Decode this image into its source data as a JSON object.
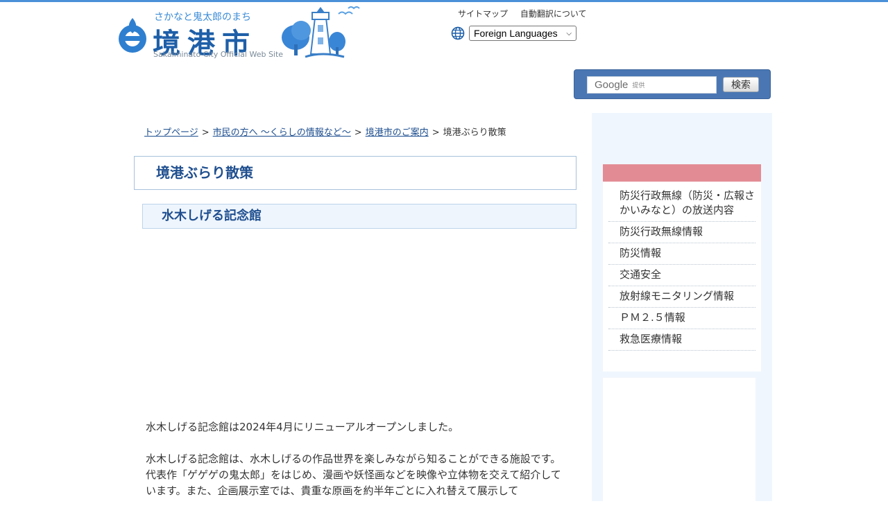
{
  "header": {
    "tagline": "さかなと鬼太郎のまち",
    "title": "境港市",
    "subtitle": "Sakaiminato City Official Web Site",
    "links": [
      "サイトマップ",
      "自動翻訳について"
    ],
    "language_select": "Foreign Languages"
  },
  "search": {
    "brand": "Google",
    "brand_sub": "提供",
    "button": "検索"
  },
  "breadcrumb": [
    "トップページ",
    "市民の方へ 〜くらしの情報など〜",
    "境港市のご案内",
    "境港ぶらり散策"
  ],
  "page_title": "境港ぶらり散策",
  "section_title": "水木しげる記念館",
  "content": {
    "p1": "水木しげる記念館は2024年4月にリニューアルオープンしました。",
    "p2": "水木しげる記念館は、水木しげるの作品世界を楽しみながら知ることができる施設です。代表作「ゲゲゲの鬼太郎」をはじめ、漫画や妖怪画などを映像や立体物を交えて紹介しています。また、企画展示室では、貴重な原画を約半年ごとに入れ替えて展示して"
  },
  "sidebar": {
    "items": [
      "防災行政無線（防災・広報さかいみなと）の放送内容",
      "防災行政無線情報",
      "防災情報",
      "交通安全",
      "放射線モニタリング情報",
      "ＰＭ２.５情報",
      "救急医療情報"
    ]
  },
  "colors": {
    "accent": "#4a90d9",
    "title_text": "#1f4f8f",
    "sidebar_header": "#e38b94",
    "search_bar": "#4a77b4"
  }
}
